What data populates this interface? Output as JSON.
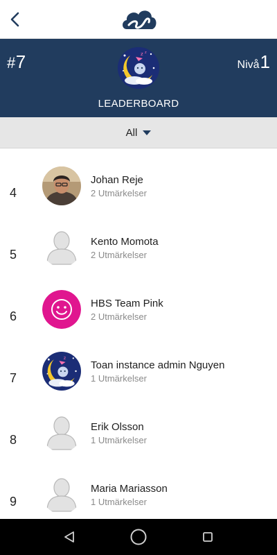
{
  "topbar": {
    "back_icon": "chevron-left-icon",
    "logo_icon": "cloud-logo-icon",
    "brand_color": "#213c5e"
  },
  "header": {
    "rank_hash": "#",
    "rank_value": "7",
    "level_label": "Nivå",
    "level_value": "1",
    "avatar_icon": "moon-baby-avatar",
    "title": "LEADERBOARD",
    "background": "#213c5e"
  },
  "filter": {
    "selected": "All",
    "caret_icon": "caret-down-icon",
    "background": "#e6e6e6"
  },
  "leaderboard": [
    {
      "rank": "4",
      "name": "Johan Reje",
      "awards": "2 Utmärkelser",
      "avatar": "photo-avatar"
    },
    {
      "rank": "5",
      "name": "Kento Momota",
      "awards": "2 Utmärkelser",
      "avatar": "default-person-avatar"
    },
    {
      "rank": "6",
      "name": "HBS Team Pink",
      "awards": "2 Utmärkelser",
      "avatar": "smiley-avatar",
      "avatar_color": "#e0168f"
    },
    {
      "rank": "7",
      "name": "Toan instance admin Nguyen",
      "awards": "1 Utmärkelser",
      "avatar": "moon-baby-avatar"
    },
    {
      "rank": "8",
      "name": "Erik Olsson",
      "awards": "1 Utmärkelser",
      "avatar": "default-person-avatar"
    },
    {
      "rank": "9",
      "name": "Maria Mariasson",
      "awards": "1 Utmärkelser",
      "avatar": "default-person-avatar"
    }
  ],
  "navbar": {
    "back_icon": "triangle-back-icon",
    "home_icon": "circle-home-icon",
    "recents_icon": "square-recents-icon"
  }
}
